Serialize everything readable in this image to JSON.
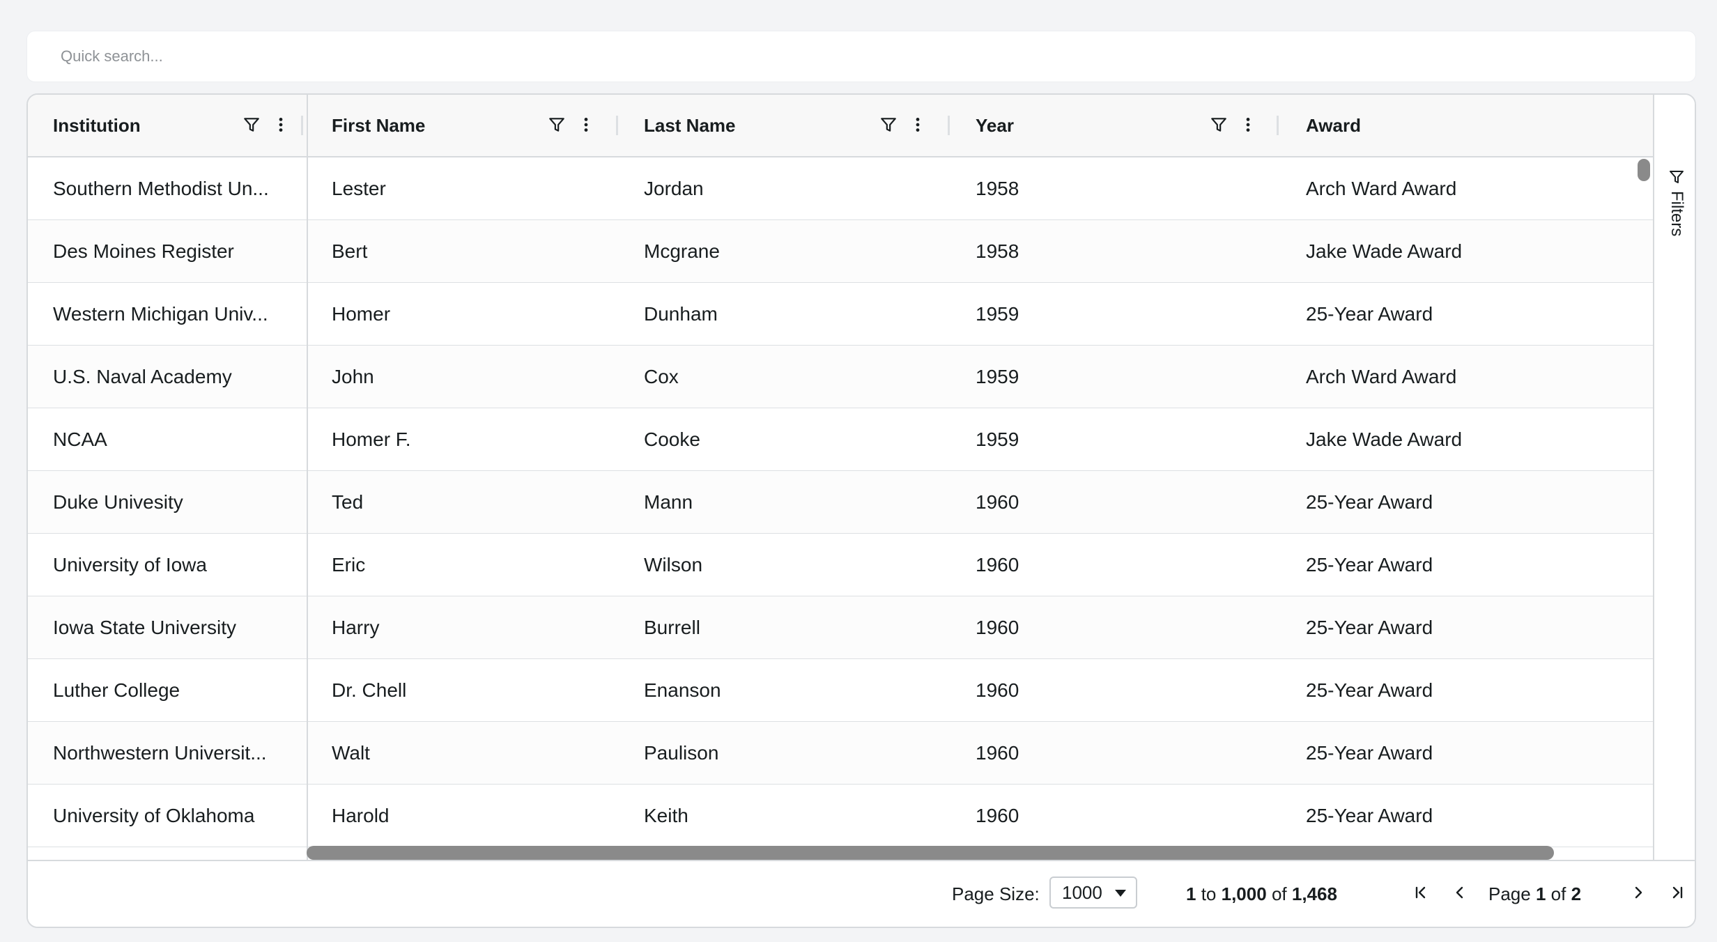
{
  "search": {
    "placeholder": "Quick search..."
  },
  "grid": {
    "columns": [
      {
        "label": "Institution",
        "has_icons": true
      },
      {
        "label": "First Name",
        "has_icons": true
      },
      {
        "label": "Last Name",
        "has_icons": true
      },
      {
        "label": "Year",
        "has_icons": true
      },
      {
        "label": "Award",
        "has_icons": false
      }
    ],
    "rows": [
      [
        "Southern Methodist Un...",
        "Lester",
        "Jordan",
        "1958",
        "Arch Ward Award"
      ],
      [
        "Des Moines Register",
        "Bert",
        "Mcgrane",
        "1958",
        "Jake Wade Award"
      ],
      [
        "Western Michigan Univ...",
        "Homer",
        "Dunham",
        "1959",
        "25-Year Award"
      ],
      [
        "U.S. Naval Academy",
        "John",
        "Cox",
        "1959",
        "Arch Ward Award"
      ],
      [
        "NCAA",
        "Homer F.",
        "Cooke",
        "1959",
        "Jake Wade Award"
      ],
      [
        "Duke Univesity",
        "Ted",
        "Mann",
        "1960",
        "25-Year Award"
      ],
      [
        "University of Iowa",
        "Eric",
        "Wilson",
        "1960",
        "25-Year Award"
      ],
      [
        "Iowa State University",
        "Harry",
        "Burrell",
        "1960",
        "25-Year Award"
      ],
      [
        "Luther College",
        "Dr. Chell",
        "Enanson",
        "1960",
        "25-Year Award"
      ],
      [
        "Northwestern Universit...",
        "Walt",
        "Paulison",
        "1960",
        "25-Year Award"
      ],
      [
        "University of Oklahoma",
        "Harold",
        "Keith",
        "1960",
        "25-Year Award"
      ]
    ]
  },
  "sidebar": {
    "filters_label": "Filters"
  },
  "footer": {
    "page_size_label": "Page Size:",
    "page_size_value": "1000",
    "range_start": "1",
    "range_to": "to",
    "range_end": "1,000",
    "range_of": "of",
    "range_total": "1,468",
    "page_word": "Page",
    "page_current": "1",
    "page_of": "of",
    "page_total": "2"
  },
  "icons": {
    "filter": "filter-icon",
    "menu": "vertical-dots-icon",
    "first": "first-page-icon",
    "prev": "previous-page-icon",
    "next": "next-page-icon",
    "last": "last-page-icon"
  }
}
